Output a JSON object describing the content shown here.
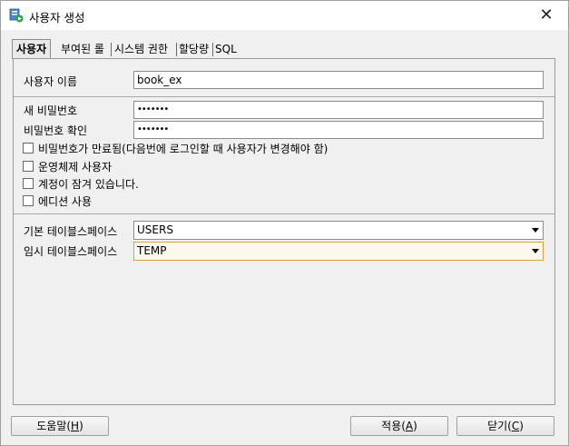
{
  "window": {
    "title": "사용자 생성",
    "close_symbol": "✕"
  },
  "tabs": [
    {
      "label": "사용자",
      "active": true
    },
    {
      "label": "부여된 롤",
      "active": false
    },
    {
      "label": "시스템 권한",
      "active": false
    },
    {
      "label": "할당량",
      "active": false
    },
    {
      "label": "SQL",
      "active": false
    }
  ],
  "form": {
    "username_label": "사용자 이름",
    "username_value": "book_ex",
    "new_password_label": "새 비밀번호",
    "new_password_value": "•••••••",
    "confirm_password_label": "비밀번호 확인",
    "confirm_password_value": "•••••••",
    "options": [
      {
        "label": "비밀번호가 만료됨(다음번에 로그인할 때 사용자가 변경해야 함)",
        "checked": false
      },
      {
        "label": "운영체제 사용자",
        "checked": false
      },
      {
        "label": "계정이 잠겨 있습니다.",
        "checked": false
      },
      {
        "label": "에디션 사용",
        "checked": false
      }
    ],
    "default_tablespace_label": "기본 테이블스페이스",
    "default_tablespace_value": "USERS",
    "temp_tablespace_label": "임시 테이블스페이스",
    "temp_tablespace_value": "TEMP"
  },
  "buttons": {
    "help_label": "도움말(",
    "help_key": "H",
    "apply_label": "적용(",
    "apply_key": "A",
    "close_label": "닫기(",
    "close_key": "C",
    "paren_close": ")"
  }
}
